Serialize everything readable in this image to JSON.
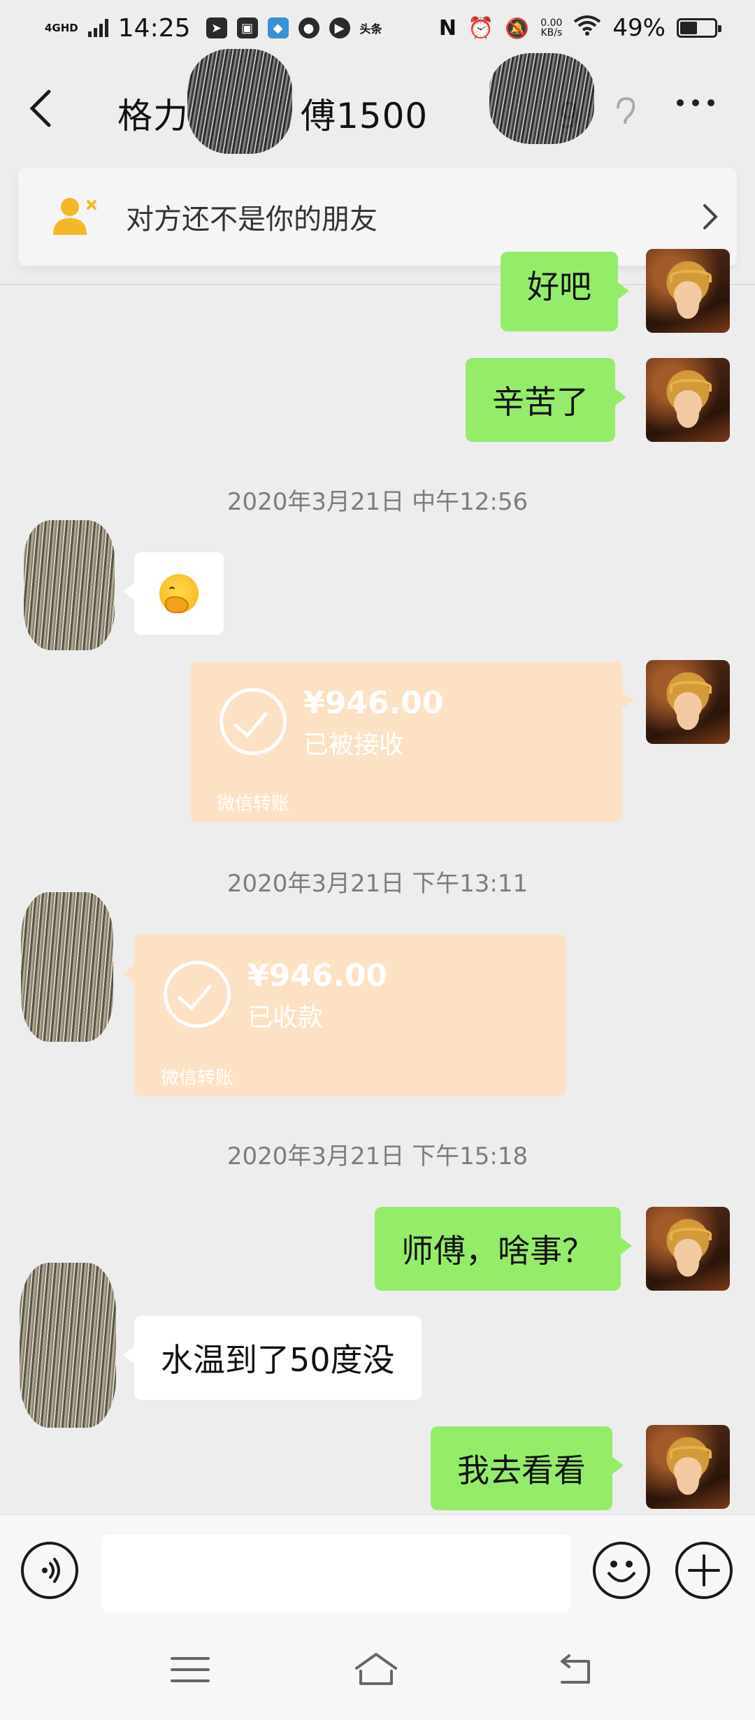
{
  "status_bar": {
    "network": "4GHD",
    "time": "14:25",
    "app_badge": "头条",
    "net_speed_value": "0.00",
    "net_speed_unit": "KB/s",
    "battery": "49%"
  },
  "nav": {
    "title_prefix": "格力",
    "title_mid": "傅1500",
    "title_end": "9"
  },
  "friend_banner": {
    "text": "对方还不是你的朋友"
  },
  "messages": {
    "m1": "好吧",
    "m2": "辛苦了",
    "ts1": "2020年3月21日 中午12:56",
    "transfer1": {
      "amount": "¥946.00",
      "status": "已被接收",
      "footer": "微信转账"
    },
    "ts2": "2020年3月21日 下午13:11",
    "transfer2": {
      "amount": "¥946.00",
      "status": "已收款",
      "footer": "微信转账"
    },
    "ts3": "2020年3月21日 下午15:18",
    "m3": "师傅，啥事？",
    "m4": "水温到了50度没",
    "m5": "我去看看"
  },
  "input": {
    "placeholder": ""
  },
  "colors": {
    "outgoing_bubble": "#95ec69",
    "incoming_bubble": "#ffffff",
    "transfer_bubble": "#fde1c4",
    "background": "#ededed",
    "friend_icon": "#f5b72a"
  }
}
